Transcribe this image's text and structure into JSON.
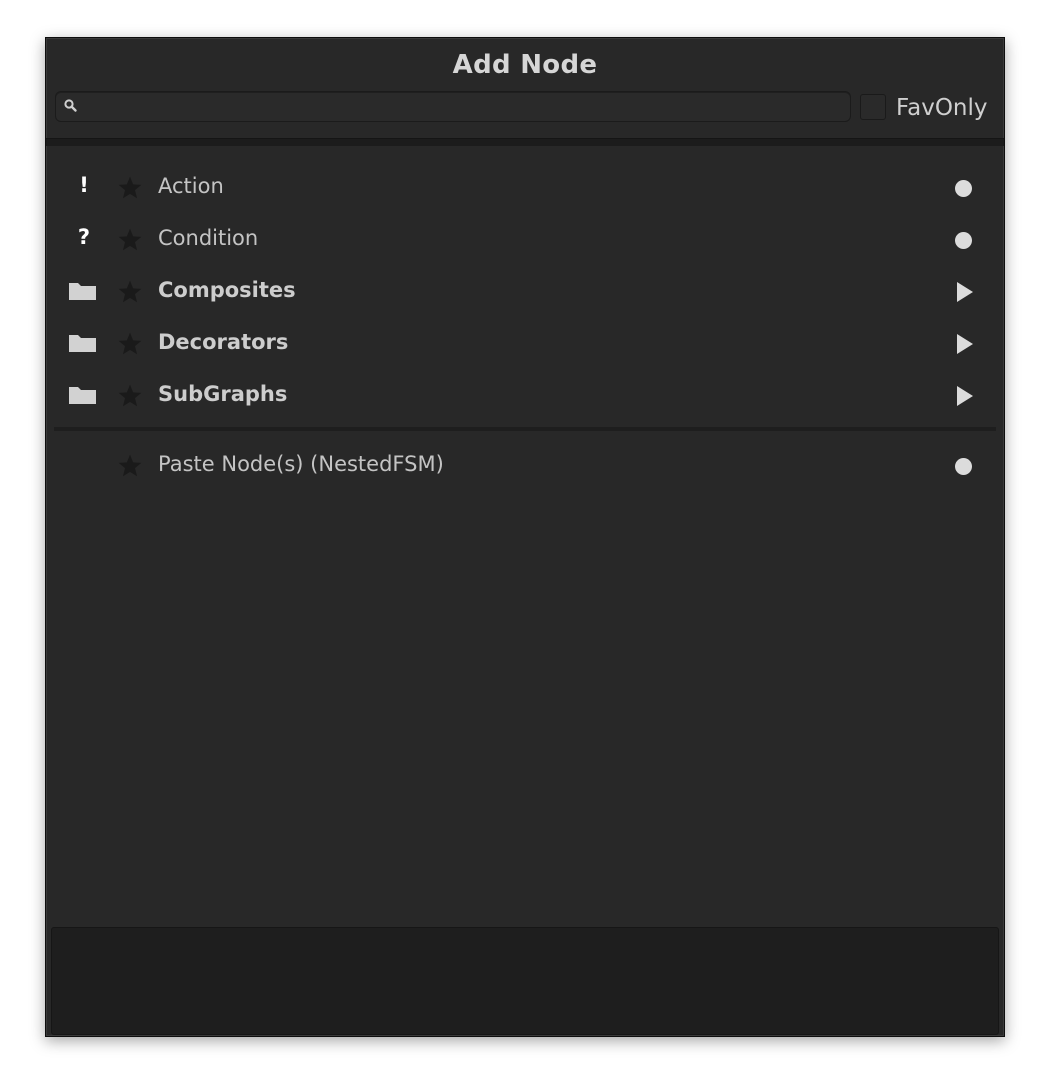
{
  "window": {
    "title": "Add Node"
  },
  "search": {
    "value": "",
    "placeholder": ""
  },
  "fav_only": {
    "label": "FavOnly",
    "checked": false
  },
  "items": [
    {
      "label": "Action",
      "type_icon": "exclamation-icon",
      "type_glyph": "!",
      "favorite": false,
      "kind": "leaf",
      "bold": false
    },
    {
      "label": "Condition",
      "type_icon": "question-icon",
      "type_glyph": "?",
      "favorite": false,
      "kind": "leaf",
      "bold": false
    },
    {
      "label": "Composites",
      "type_icon": "folder-icon",
      "favorite": false,
      "kind": "category",
      "bold": true
    },
    {
      "label": "Decorators",
      "type_icon": "folder-icon",
      "favorite": false,
      "kind": "category",
      "bold": true
    },
    {
      "label": "SubGraphs",
      "type_icon": "folder-icon",
      "favorite": false,
      "kind": "category",
      "bold": true
    }
  ],
  "extra_items": [
    {
      "label": "Paste Node(s) (NestedFSM)",
      "favorite": false,
      "kind": "leaf"
    }
  ],
  "colors": {
    "background": "#282828",
    "text": "#c4c4c4",
    "star": "#1a1a1a",
    "indicator": "#dcdcdc"
  }
}
